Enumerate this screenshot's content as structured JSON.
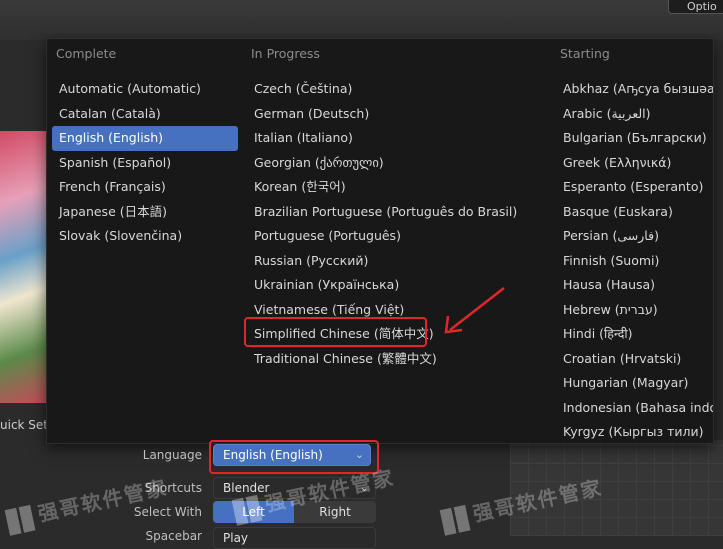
{
  "window": {
    "corner_button_label": "Optio",
    "quick_setup_label": "uick Set"
  },
  "language_menu": {
    "columns": [
      {
        "header": "Complete",
        "items": [
          "Automatic (Automatic)",
          "Catalan (Català)",
          "English (English)",
          "Spanish (Español)",
          "French (Français)",
          "Japanese (日本語)",
          "Slovak (Slovenčina)"
        ],
        "selected_index": 2
      },
      {
        "header": "In Progress",
        "items": [
          "Czech (Čeština)",
          "German (Deutsch)",
          "Italian (Italiano)",
          "Georgian (ქართული)",
          "Korean (한국어)",
          "Brazilian Portuguese (Português do Brasil)",
          "Portuguese (Português)",
          "Russian (Русский)",
          "Ukrainian (Українська)",
          "Vietnamese (Tiếng Việt)",
          "Simplified Chinese (简体中文)",
          "Traditional Chinese (繁體中文)"
        ],
        "highlighted_index": 10
      },
      {
        "header": "Starting",
        "items": [
          "Abkhaz (Аҧсуа бызшәа)",
          "Arabic (العربية)",
          "Bulgarian (Български)",
          "Greek (Ελληνικά)",
          "Esperanto (Esperanto)",
          "Basque (Euskara)",
          "Persian (فارسی)",
          "Finnish (Suomi)",
          "Hausa (Hausa)",
          "Hebrew (עברית)",
          "Hindi (हिन्दी)",
          "Croatian (Hrvatski)",
          "Hungarian (Magyar)",
          "Indonesian (Bahasa indon",
          "Kyrgyz (Кыргыз тили)"
        ]
      }
    ]
  },
  "properties": {
    "language": {
      "label": "Language",
      "value": "English (English)"
    },
    "shortcuts": {
      "label": "Shortcuts",
      "value": "Blender"
    },
    "select_with": {
      "label": "Select With",
      "options": [
        "Left",
        "Right"
      ],
      "active_index": 0
    },
    "spacebar": {
      "label": "Spacebar",
      "value": "Play"
    }
  },
  "watermarks": [
    "强哥软件管家",
    "强哥软件管家",
    "强哥软件管家"
  ],
  "colors": {
    "accent": "#4671c1",
    "annotation_red": "#e0262b",
    "menu_bg": "#181818"
  }
}
